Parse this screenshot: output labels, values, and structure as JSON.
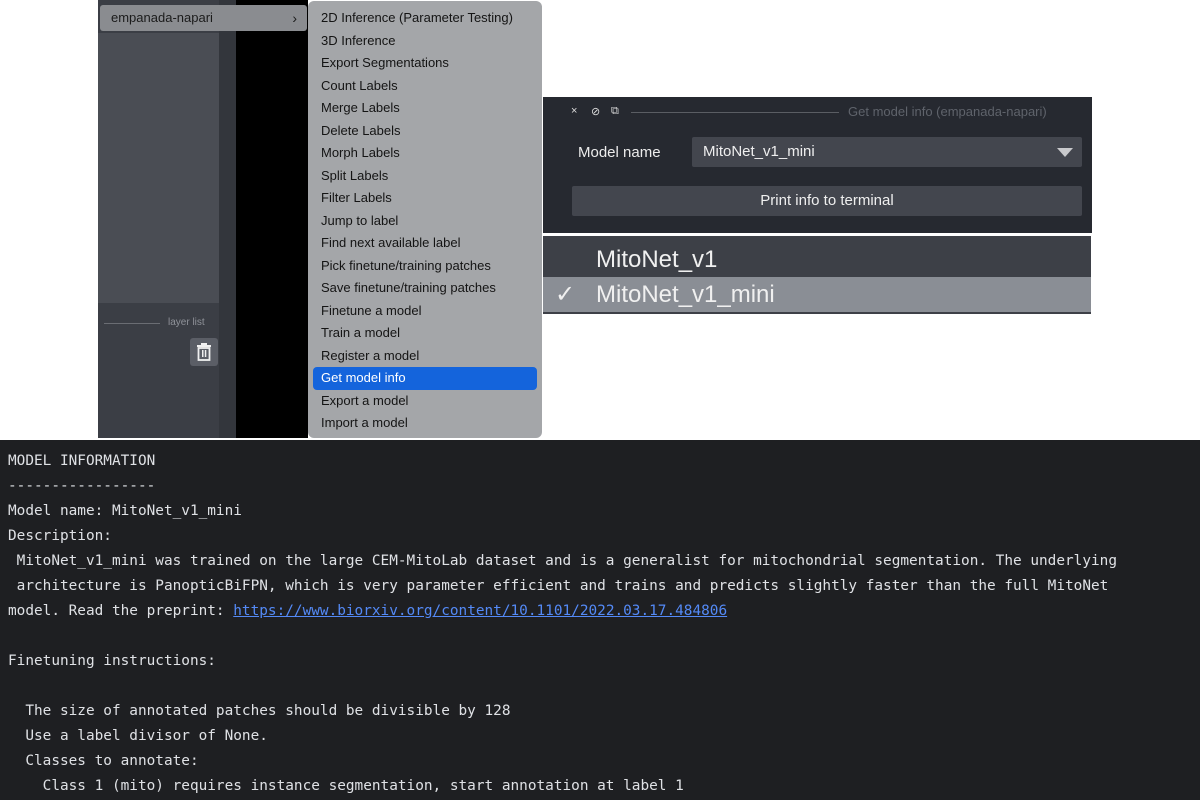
{
  "napari": {
    "plugin_menu_label": "empanada-napari",
    "plugin_menu_arrow": "›",
    "layer_list_label": "layer list",
    "trash_icon": "trash-icon",
    "submenu_items": [
      "2D Inference (Parameter Testing)",
      "3D Inference",
      "Export Segmentations",
      "Count Labels",
      "Merge Labels",
      "Delete Labels",
      "Morph Labels",
      "Split Labels",
      "Filter Labels",
      "Jump to label",
      "Find next available label",
      "Pick finetune/training patches",
      "Save finetune/training patches",
      "Finetune a model",
      "Train a model",
      "Register a model",
      "Get model info",
      "Export a model",
      "Import a model"
    ],
    "active_item": "Get model info"
  },
  "dock": {
    "title_icons": [
      "×",
      "⊘",
      "⧉"
    ],
    "title": "Get model info (empanada-napari)",
    "model_name_label": "Model name",
    "selected_model": "MitoNet_v1_mini",
    "print_button": "Print info to terminal"
  },
  "dropdown": {
    "options": [
      "MitoNet_v1",
      "MitoNet_v1_mini"
    ],
    "check_mark": "✓",
    "selected_option": "MitoNet_v1_mini"
  },
  "terminal": {
    "lines": [
      "MODEL INFORMATION",
      "-----------------",
      "Model name: MitoNet_v1_mini",
      "Description:",
      " MitoNet_v1_mini was trained on the large CEM-MitoLab dataset and is a generalist for mitochondrial segmentation. The underlying",
      " architecture is PanopticBiFPN, which is very parameter efficient and trains and predicts slightly faster than the full MitoNet",
      "model. Read the preprint: ",
      "",
      "Finetuning instructions:",
      "",
      "  The size of annotated patches should be divisible by 128",
      "  Use a label divisor of None.",
      "  Classes to annotate:",
      "    Class 1 (mito) requires instance segmentation, start annotation at label 1"
    ],
    "link_text": "https://www.biorxiv.org/content/10.1101/2022.03.17.484806"
  }
}
